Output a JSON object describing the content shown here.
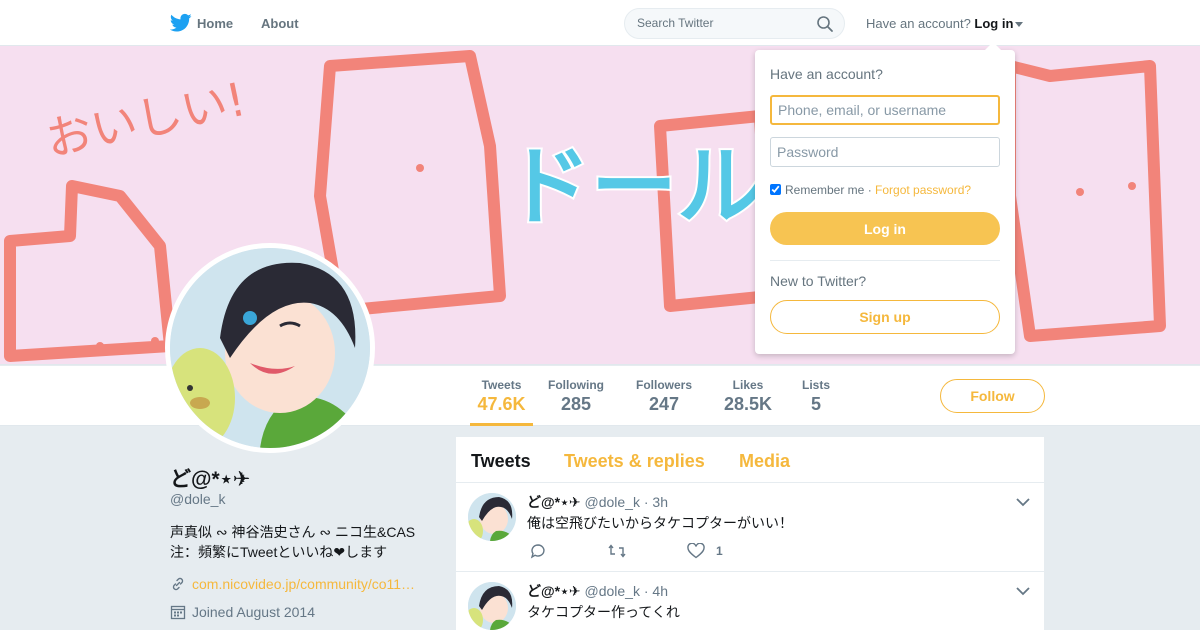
{
  "topbar": {
    "home_label": "Home",
    "about_label": "About",
    "search_placeholder": "Search Twitter",
    "account_prompt": "Have an account?",
    "login_label": "Log in"
  },
  "banner": {
    "text_oishii": "おいしい!",
    "text_dole": "ドール"
  },
  "profile": {
    "name": "ど@*⋆✈",
    "handle": "@dole_k",
    "bio_line1": "声真似 ∾ 神谷浩史さん ∾ ニコ生&CAS",
    "bio_line2": "注：頻繁にTweetといいね❤します",
    "link": "com.nicovideo.jp/community/co11…",
    "joined": "Joined August 2014"
  },
  "stats": [
    {
      "label": "Tweets",
      "value": "47.6K",
      "active": true
    },
    {
      "label": "Following",
      "value": "285"
    },
    {
      "label": "Followers",
      "value": "247"
    },
    {
      "label": "Likes",
      "value": "28.5K"
    },
    {
      "label": "Lists",
      "value": "5"
    }
  ],
  "follow_label": "Follow",
  "timeline": {
    "tabs": [
      "Tweets",
      "Tweets & replies",
      "Media"
    ],
    "tweets": [
      {
        "name": "ど@*⋆✈",
        "handle": "@dole_k",
        "time": "3h",
        "text": "俺は空飛びたいからタケコプターがいい！",
        "likes": "1"
      },
      {
        "name": "ど@*⋆✈",
        "handle": "@dole_k",
        "time": "4h",
        "text": "タケコプター作ってくれ",
        "likes": ""
      }
    ]
  },
  "login_dropdown": {
    "title": "Have an account?",
    "username_placeholder": "Phone, email, or username",
    "password_placeholder": "Password",
    "remember_label": "Remember me",
    "separator": " · ",
    "forgot_label": "Forgot password?",
    "login_button": "Log in",
    "new_prompt": "New to Twitter?",
    "signup_button": "Sign up"
  },
  "colors": {
    "accent": "#f5b83d",
    "banner_bg": "#f6dff0",
    "banner_box": "#f2847a",
    "banner_text": "#55c8e6",
    "twitter_blue": "#1da1f2"
  }
}
